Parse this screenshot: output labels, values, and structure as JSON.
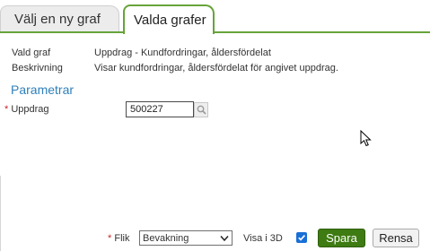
{
  "tabs": [
    {
      "label": "Välj en ny graf",
      "active": false
    },
    {
      "label": "Valda grafer",
      "active": true
    }
  ],
  "info": {
    "graph_label": "Vald graf",
    "graph_value": "Uppdrag - Kundfordringar, åldersfördelat",
    "description_label": "Beskrivning",
    "description_value": "Visar kundfordringar, åldersfördelat för angivet uppdrag."
  },
  "parameters": {
    "header": "Parametrar",
    "required_marker": "*",
    "uppdrag_label": "Uppdrag",
    "uppdrag_value": "500227"
  },
  "footer": {
    "required_marker": "*",
    "tab_label": "Flik",
    "tab_selected": "Bevakning",
    "show_3d_label": "Visa i 3D",
    "show_3d_checked": true,
    "save_label": "Spara",
    "cancel_label": "Rensa"
  },
  "icons": {
    "lookup": "magnifier-icon",
    "dropdown": "chevron-down-icon",
    "checkbox": "checkmark-icon",
    "cursor": "mouse-pointer-icon"
  },
  "colors": {
    "accent_green": "#66a43a",
    "save_green": "#3e7b12",
    "header_blue": "#2f7fba",
    "required_red": "#cc2222",
    "checkbox_blue": "#1a6fd6"
  }
}
